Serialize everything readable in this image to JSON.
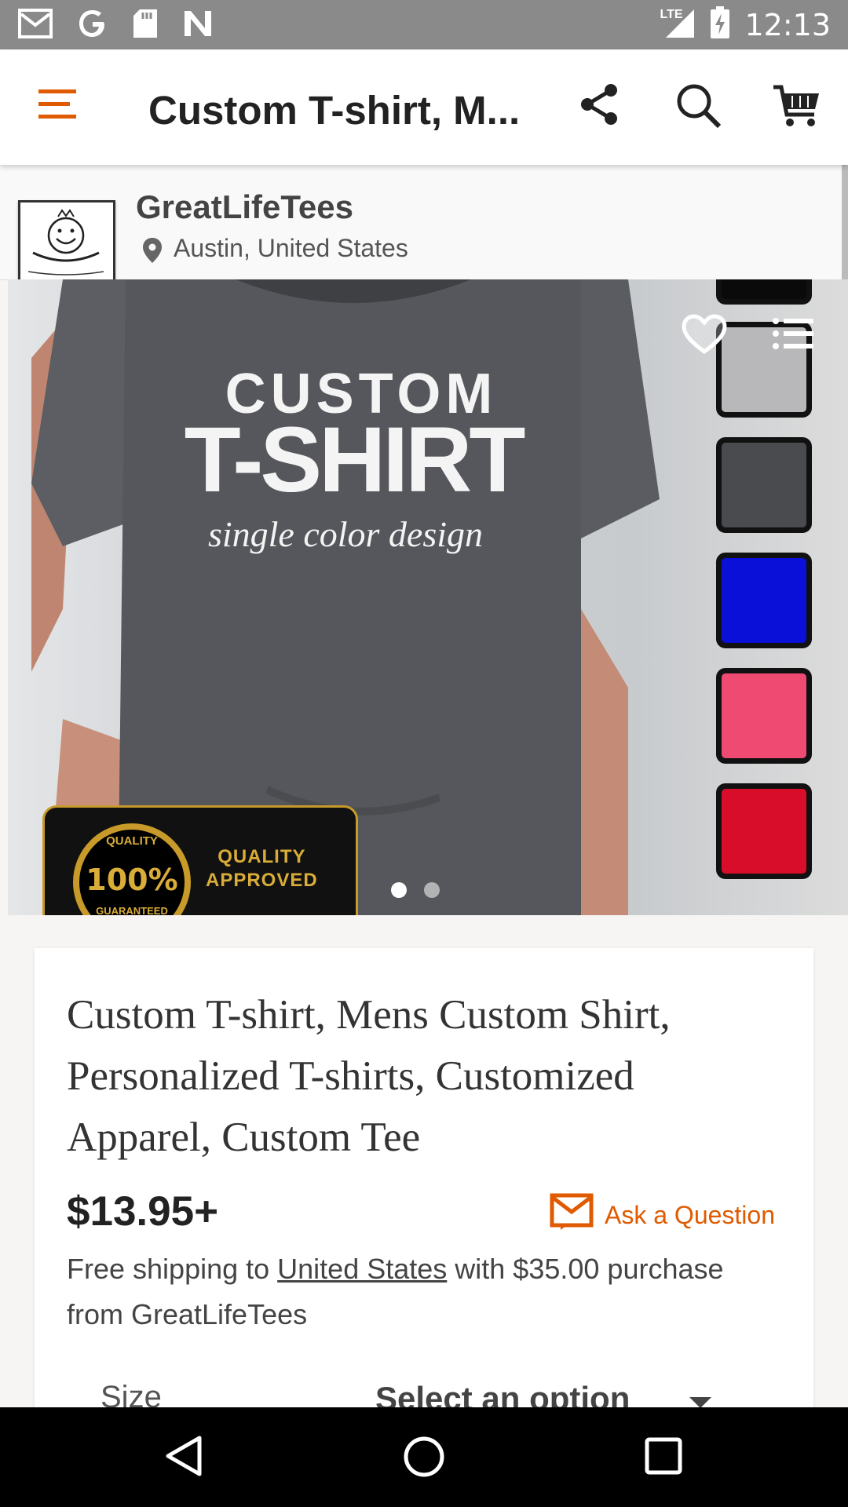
{
  "status_bar": {
    "time": "12:13",
    "network": "LTE",
    "icons_left": [
      "gmail-icon",
      "google-icon",
      "sd-card-icon",
      "n-app-icon"
    ]
  },
  "app_bar": {
    "title": "Custom T-shirt, M...",
    "icons": [
      "menu-icon",
      "share-icon",
      "search-icon",
      "cart-icon"
    ],
    "accent_color": "#e05a00"
  },
  "shop": {
    "name": "GreatLifeTees",
    "location": "Austin, United States"
  },
  "hero": {
    "print_line1": "CUSTOM",
    "print_line2": "T-SHIRT",
    "print_line3": "single color design",
    "badge_top": "QUALITY",
    "badge_percent": "100%",
    "badge_bottom": "GUARANTEED",
    "badge_text_1": "QUALITY",
    "badge_text_2": "APPROVED",
    "swatch_colors": [
      "#0a0a0a",
      "#b8b8bb",
      "#4a4b4f",
      "#0a10d8",
      "#ee4a72",
      "#d80d2a"
    ],
    "dots_total": 2,
    "dots_active": 1
  },
  "product": {
    "title": "Custom T-shirt, Mens Custom Shirt, Personalized T-shirts, Customized Apparel, Custom Tee",
    "price": "$13.95+",
    "ask_question": "Ask a Question",
    "shipping_prefix": "Free shipping to ",
    "shipping_country": "United States",
    "shipping_suffix": " with $35.00 purchase from GreatLifeTees",
    "size_label": "Size",
    "size_select": "Select an option"
  }
}
